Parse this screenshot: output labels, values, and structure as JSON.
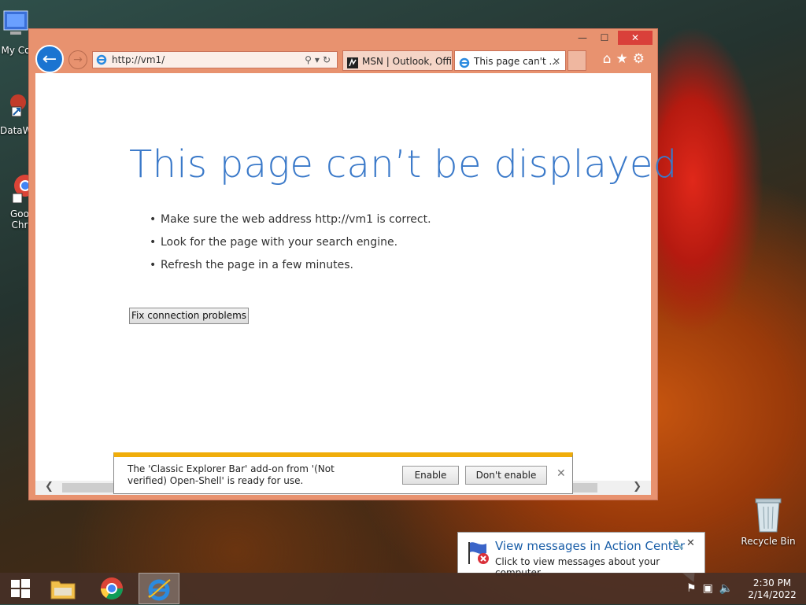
{
  "desktop": {
    "icons": [
      {
        "label": "My Co"
      },
      {
        "label": "DataW"
      },
      {
        "label": "Goo Chr"
      }
    ],
    "recycle_bin": "Recycle Bin"
  },
  "browser": {
    "window_controls": {
      "minimize": "—",
      "maximize": "☐",
      "close": "✕"
    },
    "address_url": "http://vm1/",
    "tabs": [
      {
        "label": "MSN | Outlook, Offi..."
      },
      {
        "label": "This page can't ..."
      }
    ],
    "error": {
      "title": "This page can’t be displayed",
      "bullets": [
        "Make sure the web address http://vm1 is correct.",
        "Look for the page with your search engine.",
        "Refresh the page in a few minutes."
      ],
      "fix_button": "Fix connection problems"
    },
    "notification": {
      "message": "The 'Classic Explorer Bar' add-on from '(Not verified) Open-Shell' is ready for use.",
      "enable": "Enable",
      "dont_enable": "Don't enable"
    }
  },
  "action_center": {
    "title": "View messages in Action Center",
    "subtitle": "Click to view messages about your computer."
  },
  "taskbar": {
    "time": "2:30 PM",
    "date": "2/14/2022"
  }
}
